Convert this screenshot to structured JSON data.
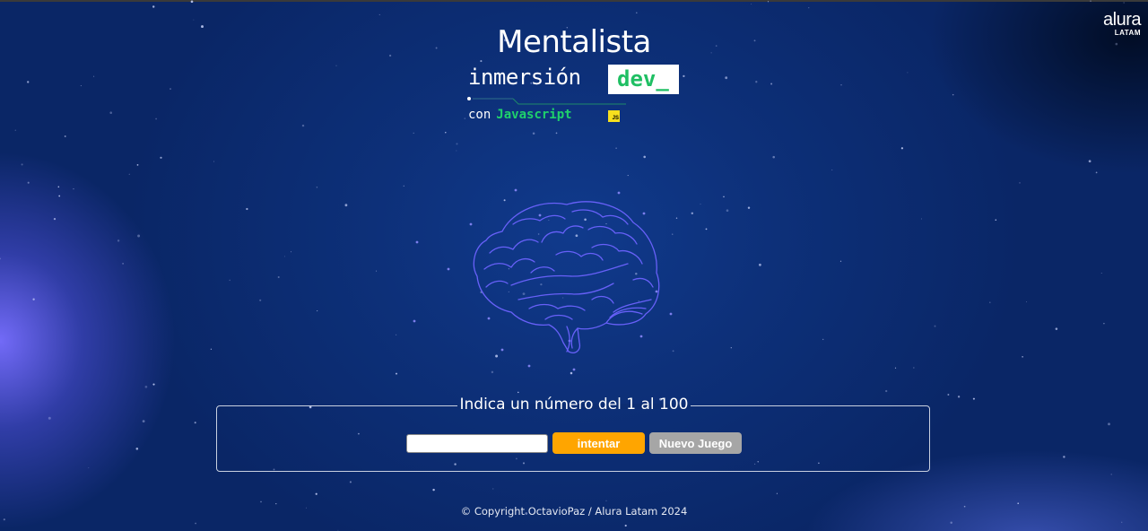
{
  "brand": {
    "name": "alura",
    "sub": "LATAM"
  },
  "header": {
    "title": "Mentalista",
    "subtitle": "inmersión",
    "tag": "dev_",
    "con": "con",
    "language": "Javascript",
    "badge": "JS"
  },
  "game": {
    "legend": "Indica un número del 1 al 100",
    "input_value": "",
    "try_label": "intentar",
    "new_label": "Nuevo Juego"
  },
  "footer": {
    "text": "© Copyright OctavioPaz / Alura Latam 2024"
  },
  "colors": {
    "background": "#0a2666",
    "accent_green": "#1fbf63",
    "try_button": "#ffa500",
    "new_button": "#a6a6a6",
    "brain_stroke": "#6c63ff",
    "js_badge": "#f7df1e"
  },
  "icons": {
    "brain": "brain-icon",
    "js": "javascript-badge-icon",
    "logo": "alura-logo"
  }
}
